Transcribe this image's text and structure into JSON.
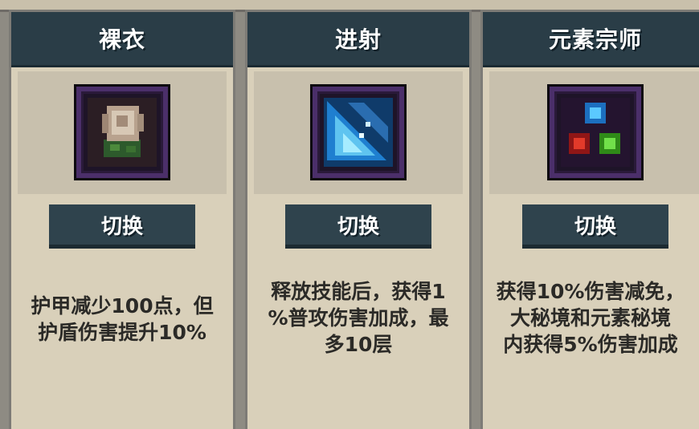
{
  "cards": [
    {
      "title": "裸衣",
      "icon": "pale-rose-icon",
      "button": "切换",
      "description": "护甲减少100点，但\n护盾伤害提升10%"
    },
    {
      "title": "进射",
      "icon": "blue-arrows-icon",
      "button": "切换",
      "description": "释放技能后，获得1\n%普攻伤害加成，最\n多10层"
    },
    {
      "title": "元素宗师",
      "icon": "element-orbs-icon",
      "button": "切换",
      "description": "获得10%伤害减免，\n大秘境和元素秘境\n内获得5%伤害加成"
    }
  ],
  "colors": {
    "header": "#2a3d47",
    "card": "#d9d0ba",
    "button": "#2f434d",
    "frame": "#4b2f6a"
  }
}
